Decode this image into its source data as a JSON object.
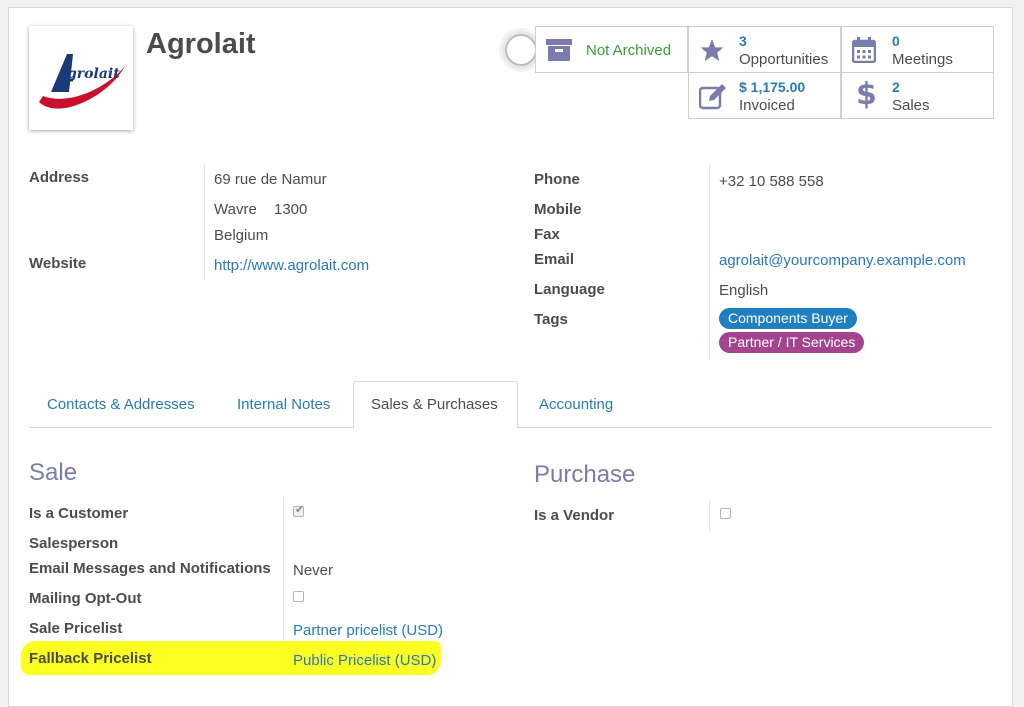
{
  "partner": {
    "name": "Agrolait",
    "logo_text": "Agrolait"
  },
  "stats": {
    "archive": {
      "label": "Not Archived",
      "icon": "archive-box-icon"
    },
    "opportunities": {
      "value": "3",
      "label": "Opportunities",
      "icon": "star-icon"
    },
    "meetings": {
      "value": "0",
      "label": "Meetings",
      "icon": "calendar-icon"
    },
    "invoiced": {
      "value": "$ 1,175.00",
      "label": "Invoiced",
      "icon": "edit-icon"
    },
    "sales": {
      "value": "2",
      "label": "Sales",
      "icon": "dollar-icon"
    }
  },
  "info": {
    "address_label": "Address",
    "street": "69 rue de Namur",
    "city": "Wavre",
    "zip": "1300",
    "country": "Belgium",
    "website_label": "Website",
    "website": "http://www.agrolait.com",
    "phone_label": "Phone",
    "phone": "+32 10 588 558",
    "mobile_label": "Mobile",
    "fax_label": "Fax",
    "email_label": "Email",
    "email": "agrolait@yourcompany.example.com",
    "language_label": "Language",
    "language": "English",
    "tags_label": "Tags",
    "tags": [
      {
        "label": "Components Buyer",
        "color": "#1f7fc1"
      },
      {
        "label": "Partner / IT Services",
        "color": "#a4448e"
      }
    ]
  },
  "tabs": [
    {
      "label": "Contacts & Addresses"
    },
    {
      "label": "Internal Notes"
    },
    {
      "label": "Sales & Purchases"
    },
    {
      "label": "Accounting"
    }
  ],
  "sale": {
    "title": "Sale",
    "is_customer_label": "Is a Customer",
    "is_customer": true,
    "salesperson_label": "Salesperson",
    "email_notif_label": "Email Messages and Notifications",
    "email_notif": "Never",
    "mailing_optout_label": "Mailing Opt-Out",
    "mailing_optout": false,
    "sale_pricelist_label": "Sale Pricelist",
    "sale_pricelist": "Partner pricelist (USD)",
    "fallback_pricelist_label": "Fallback Pricelist",
    "fallback_pricelist": "Public Pricelist (USD)"
  },
  "purchase": {
    "title": "Purchase",
    "is_vendor_label": "Is a Vendor",
    "is_vendor": false
  },
  "colors": {
    "accent": "#7c7bad",
    "link": "#2a7ab8",
    "highlight": "#fbff22"
  }
}
